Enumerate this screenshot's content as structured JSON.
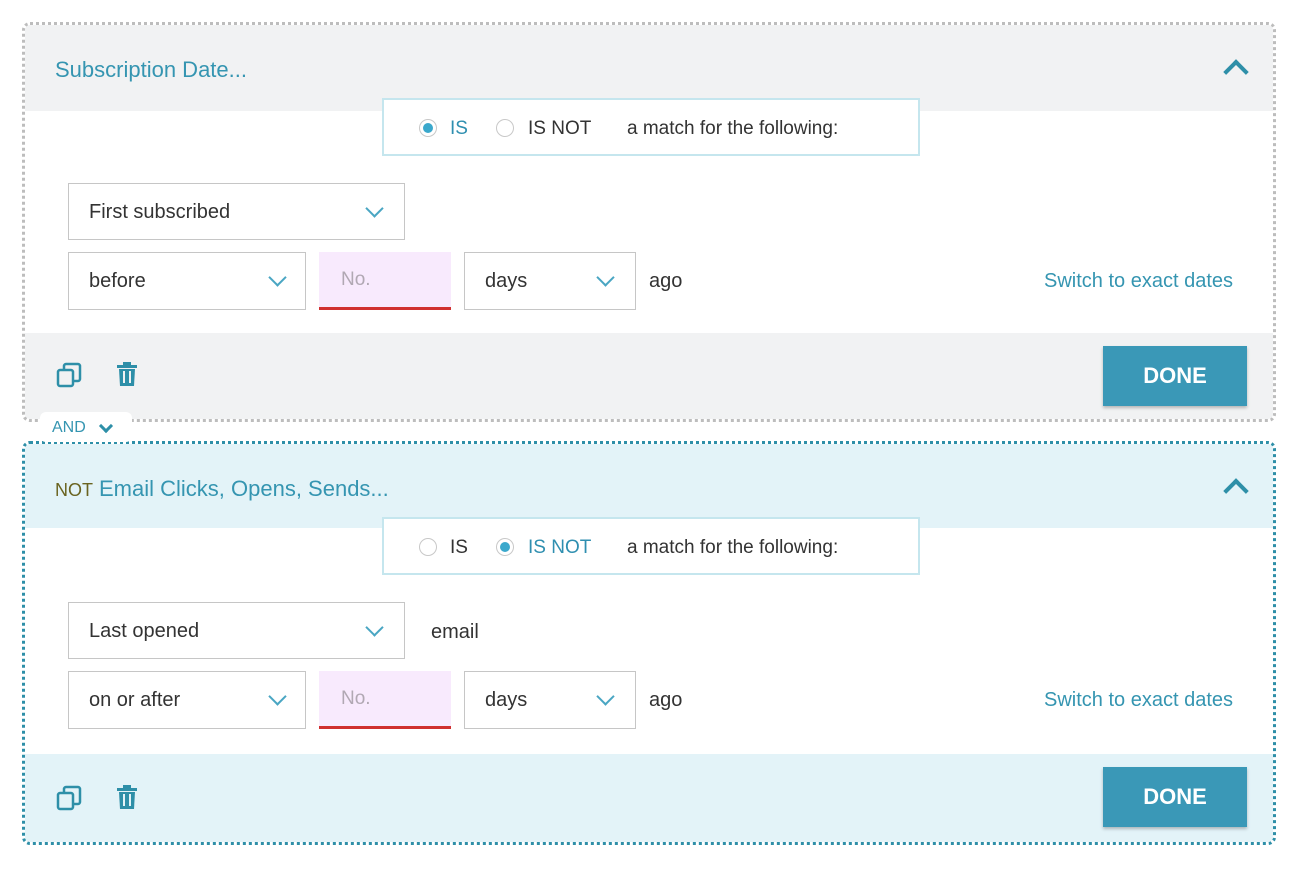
{
  "conditions": [
    {
      "title": "Subscription Date...",
      "not_label": "",
      "match": {
        "is_label": "IS",
        "is_not_label": "IS NOT",
        "selected": "IS",
        "suffix": "a match for the following:"
      },
      "field": "First subscribed",
      "field_suffix": "",
      "operator": "before",
      "number_placeholder": "No.",
      "unit": "days",
      "ago": "ago",
      "switch_link": "Switch to exact dates",
      "done_label": "DONE"
    },
    {
      "title": "Email Clicks, Opens, Sends...",
      "not_label": "NOT",
      "match": {
        "is_label": "IS",
        "is_not_label": "IS NOT",
        "selected": "IS NOT",
        "suffix": "a match for the following:"
      },
      "field": "Last opened",
      "field_suffix": "email",
      "operator": "on or after",
      "number_placeholder": "No.",
      "unit": "days",
      "ago": "ago",
      "switch_link": "Switch to exact dates",
      "done_label": "DONE"
    }
  ],
  "connector": {
    "label": "AND"
  },
  "colors": {
    "accent": "#3595b1",
    "button": "#3a98b7",
    "card2_border": "#2e8fa8",
    "number_underline": "#d0312f"
  }
}
